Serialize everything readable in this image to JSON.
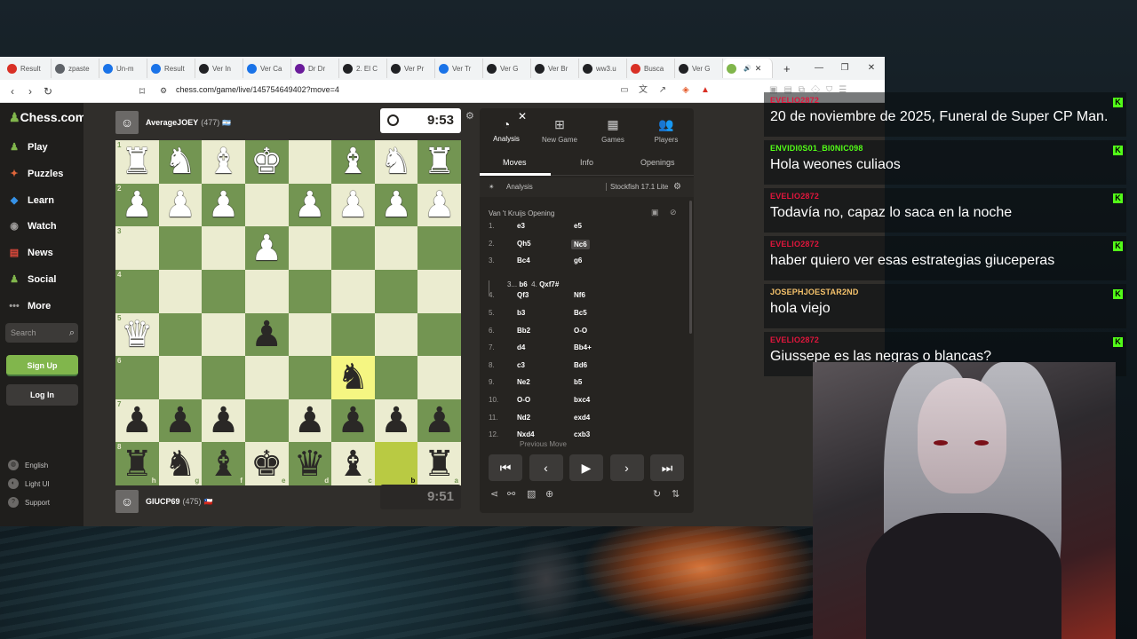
{
  "browser": {
    "tabs": [
      {
        "label": "Result",
        "color": "#d93025",
        "active": false
      },
      {
        "label": "zpaste",
        "color": "#5f6368",
        "active": false
      },
      {
        "label": "Un-m",
        "color": "#1a73e8",
        "active": false
      },
      {
        "label": "Result",
        "color": "#1a73e8",
        "active": false
      },
      {
        "label": "Ver In",
        "color": "#202124",
        "active": false
      },
      {
        "label": "Ver Ca",
        "color": "#1a73e8",
        "active": false
      },
      {
        "label": "Dr Dr",
        "color": "#6a1b9a",
        "active": false
      },
      {
        "label": "2. El C",
        "color": "#202124",
        "active": false
      },
      {
        "label": "Ver Pr",
        "color": "#202124",
        "active": false
      },
      {
        "label": "Ver Tr",
        "color": "#1a73e8",
        "active": false
      },
      {
        "label": "Ver G",
        "color": "#202124",
        "active": false
      },
      {
        "label": "Ver Br",
        "color": "#202124",
        "active": false
      },
      {
        "label": "ww3.u",
        "color": "#202124",
        "active": false
      },
      {
        "label": "Busca",
        "color": "#d93025",
        "active": false
      },
      {
        "label": "Ver G",
        "color": "#202124",
        "active": false
      },
      {
        "label": "",
        "color": "#81b64c",
        "active": true
      }
    ],
    "url": "chess.com/game/live/145754649402?move=4"
  },
  "sidebar": {
    "brand": "Chess.com",
    "items": [
      {
        "label": "Play",
        "icon": "♟"
      },
      {
        "label": "Puzzles",
        "icon": "✦"
      },
      {
        "label": "Learn",
        "icon": "◆"
      },
      {
        "label": "Watch",
        "icon": "◉"
      },
      {
        "label": "News",
        "icon": "▤"
      },
      {
        "label": "Social",
        "icon": "♟"
      },
      {
        "label": "More",
        "icon": "•••"
      }
    ],
    "search_placeholder": "Search",
    "signup": "Sign Up",
    "login": "Log In",
    "footer": [
      {
        "label": "English"
      },
      {
        "label": "Light UI"
      },
      {
        "label": "Support"
      }
    ]
  },
  "game": {
    "top_player": {
      "name": "AverageJOEY",
      "rating": "(477)",
      "flag": "🇦🇷"
    },
    "bottom_player": {
      "name": "GIUCP69",
      "rating": "(475)",
      "flag": "🇨🇱"
    },
    "top_clock": "9:53",
    "bottom_clock": "9:51",
    "ranks": [
      "1",
      "2",
      "3",
      "4",
      "5",
      "6",
      "7",
      "8"
    ],
    "files": [
      "h",
      "g",
      "f",
      "e",
      "d",
      "c",
      "b",
      "a"
    ],
    "board": [
      [
        "wR",
        "wN",
        "wB",
        "wK",
        "",
        "wB",
        "wN",
        "wR"
      ],
      [
        "wP",
        "wP",
        "wP",
        "",
        "wP",
        "wP",
        "wP",
        "wP"
      ],
      [
        "",
        "",
        "",
        "wP",
        "",
        "",
        "",
        ""
      ],
      [
        "",
        "",
        "",
        "",
        "",
        "",
        "",
        ""
      ],
      [
        "wQ",
        "",
        "",
        "bP",
        "",
        "",
        "",
        ""
      ],
      [
        "",
        "",
        "",
        "",
        "",
        "bN",
        "",
        ""
      ],
      [
        "bP",
        "bP",
        "bP",
        "",
        "bP",
        "bP",
        "bP",
        "bP"
      ],
      [
        "bR",
        "bN",
        "bB",
        "bK",
        "bQ",
        "bB",
        "",
        "bR"
      ]
    ],
    "highlights": [
      [
        5,
        5
      ],
      [
        7,
        6
      ]
    ]
  },
  "panel": {
    "tabs": [
      {
        "label": "Analysis",
        "icon": "◔"
      },
      {
        "label": "New Game",
        "icon": "⊞"
      },
      {
        "label": "Games",
        "icon": "▦"
      },
      {
        "label": "Players",
        "icon": "👥"
      }
    ],
    "subtabs": [
      "Moves",
      "Info",
      "Openings"
    ],
    "analysis_label": "Analysis",
    "engine": "Stockfish 17.1 Lite",
    "opening": "Van 't Kruijs Opening",
    "moves": [
      {
        "n": "1.",
        "w": "e3",
        "b": "e5"
      },
      {
        "n": "2.",
        "w": "Qh5",
        "b": "Nc6"
      },
      {
        "n": "3.",
        "w": "Bc4",
        "b": "g6"
      },
      {
        "n": "4.",
        "w": "Qf3",
        "b": "Nf6"
      },
      {
        "n": "5.",
        "w": "b3",
        "b": "Bc5"
      },
      {
        "n": "6.",
        "w": "Bb2",
        "b": "O-O"
      },
      {
        "n": "7.",
        "w": "d4",
        "b": "Bb4+"
      },
      {
        "n": "8.",
        "w": "c3",
        "b": "Bd6"
      },
      {
        "n": "9.",
        "w": "Ne2",
        "b": "b5"
      },
      {
        "n": "10.",
        "w": "O-O",
        "b": "bxc4"
      },
      {
        "n": "11.",
        "w": "Nd2",
        "b": "exd4"
      },
      {
        "n": "12.",
        "w": "Nxd4",
        "b": "cxb3"
      }
    ],
    "variation": {
      "n1": "3...",
      "m1": "b6",
      "n2": "4.",
      "m2": "Qxf7#"
    },
    "tooltip": "Previous Move",
    "controls": [
      "⏮",
      "‹",
      "▶",
      "›",
      "⏭"
    ]
  },
  "chat": [
    {
      "user": "EVELIO2872",
      "color": "#e0163c",
      "text": "20 de noviembre de 2025, Funeral de Super CP Man."
    },
    {
      "user": "ENVIDI0S01_BI0NIC098",
      "color": "#53fc18",
      "text": "Hola weones culiaos"
    },
    {
      "user": "EVELIO2872",
      "color": "#e0163c",
      "text": "Todavía no, capaz lo saca en la noche"
    },
    {
      "user": "EVELIO2872",
      "color": "#e0163c",
      "text": "haber quiero ver esas estrategias giuceperas"
    },
    {
      "user": "JOSEPHJOESTAR2ND",
      "color": "#f5c26b",
      "text": "hola viejo"
    },
    {
      "user": "EVELIO2872",
      "color": "#e0163c",
      "text": "Giussepe es las negras o blancas?"
    }
  ]
}
